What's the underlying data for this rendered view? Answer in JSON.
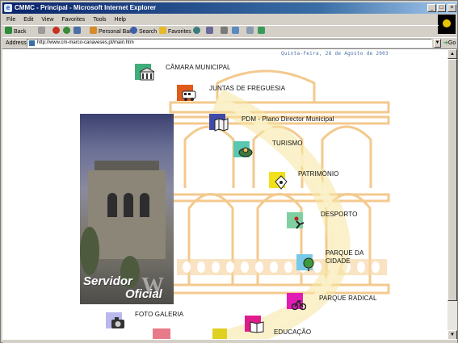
{
  "window": {
    "title": "CMMC - Principal - Microsoft Internet Explorer",
    "controls": [
      "_",
      "□",
      "×"
    ]
  },
  "menu": [
    "File",
    "Edit",
    "View",
    "Favorites",
    "Tools",
    "Help"
  ],
  "toolbar": {
    "back": "Back",
    "personal_bar": "Personal Bar",
    "search": "Search",
    "favorites": "Favorites"
  },
  "address": {
    "label": "Address",
    "url": "http://www.cm-marco-canaveses.pt/main.htm",
    "go": "Go"
  },
  "site": {
    "date": "Quinta-Feira, 28 de Agosto de 2003",
    "banner_line1": "Servidor",
    "banner_line2": "Oficial",
    "nav": [
      {
        "label": "CÂMARA MUNICIPAL",
        "icon": "building-icon",
        "color": "#3fae7a"
      },
      {
        "label": "JUNTAS DE FREGUESIA",
        "icon": "bus-icon",
        "color": "#e05a1c"
      },
      {
        "label": "PDM - Plano Director Municipal",
        "icon": "map-icon",
        "color": "#3e49a8"
      },
      {
        "label": "TURISMO",
        "icon": "tourism-icon",
        "color": "#5ac8b0"
      },
      {
        "label": "PATRIMÓNIO",
        "icon": "monument-icon",
        "color": "#f2e01a"
      },
      {
        "label": "DESPORTO",
        "icon": "sport-icon",
        "color": "#7ed0a0"
      },
      {
        "label": "PARQUE DA CIDADE",
        "icon": "tree-icon",
        "color": "#78c9e8"
      },
      {
        "label": "PARQUE RADICAL",
        "icon": "bike-icon",
        "color": "#e11cb4"
      },
      {
        "label": "FOTO GALERIA",
        "icon": "camera-icon",
        "color": "#b9b9ec"
      },
      {
        "label": "EDUCAÇÃO",
        "icon": "book-icon",
        "color": "#e01c8a"
      }
    ]
  }
}
